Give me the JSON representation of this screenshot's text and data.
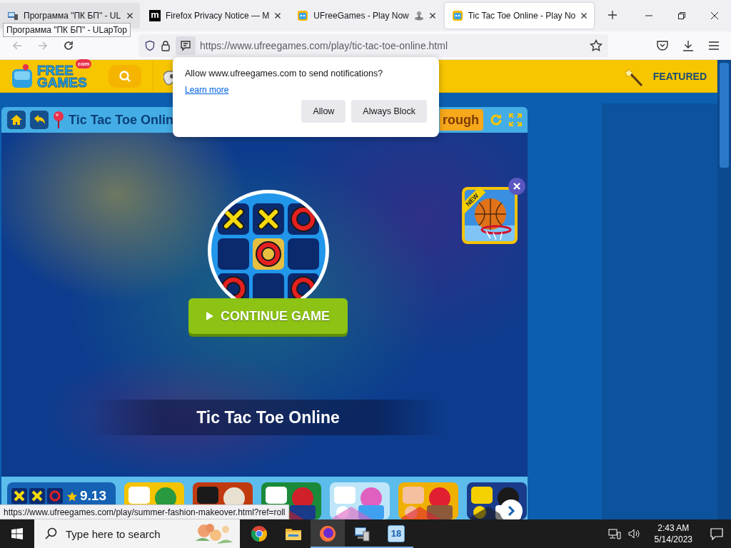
{
  "browser": {
    "tabs": [
      {
        "title": "Программа \"ПК БП\" - UL",
        "kind": "app",
        "selected": false
      },
      {
        "title": "Firefox Privacy Notice — M",
        "kind": "letter",
        "icon_text": "m",
        "selected": false
      },
      {
        "title": "UFreeGames - Play Now",
        "kind": "arcade",
        "selected": false
      },
      {
        "title": "Tic Tac Toe Online - Play No",
        "kind": "game",
        "selected": true
      }
    ],
    "tooltip": "Программа \"ПК БП\" - ULapTop",
    "url": "https://www.ufreegames.com/play/tic-tac-toe-online.html",
    "status_url": "https://www.ufreegames.com/play/summer-fashion-makeover.html?ref=roll"
  },
  "notification": {
    "message": "Allow www.ufreegames.com to send notifications?",
    "link": "Learn more",
    "buttons": [
      "Allow",
      "Always Block"
    ]
  },
  "site": {
    "logo": {
      "line1": "FREE",
      "line2": "GAMES",
      "badge": "com"
    },
    "nav": [
      "FEATURED"
    ]
  },
  "game": {
    "title": "Tic Tac Toe Onlin",
    "walkthrough": "rough",
    "board": [
      {
        "kind": "x",
        "highlighted": false
      },
      {
        "kind": "x",
        "highlighted": false
      },
      {
        "kind": "o",
        "highlighted": false
      },
      {
        "kind": "empty",
        "highlighted": false
      },
      {
        "kind": "o",
        "highlighted": true
      },
      {
        "kind": "empty",
        "highlighted": false
      },
      {
        "kind": "o",
        "highlighted": false
      },
      {
        "kind": "empty",
        "highlighted": false
      },
      {
        "kind": "o",
        "highlighted": false
      }
    ],
    "continue": "CONTINUE GAME",
    "caption": "Tic Tac Toe Online",
    "promo": {
      "ribbon": "NEW"
    }
  },
  "thumbnails": [
    {
      "kind": "rated",
      "rating": "9.13"
    },
    {
      "kind": "picture"
    },
    {
      "kind": "picture"
    },
    {
      "kind": "picture"
    },
    {
      "kind": "picture"
    },
    {
      "kind": "picture"
    },
    {
      "kind": "picture"
    }
  ],
  "taskbar": {
    "search_placeholder": "Type here to search",
    "apps": [
      {
        "kind": "chrome",
        "active": false,
        "running": false
      },
      {
        "kind": "folder",
        "active": false,
        "running": false
      },
      {
        "kind": "firefox",
        "active": true,
        "running": true
      },
      {
        "kind": "computer",
        "active": false,
        "running": true
      },
      {
        "kind": "calendar",
        "badge": "18",
        "active": false,
        "running": true
      }
    ],
    "time": "2:43 AM",
    "date": "5/14/2023"
  }
}
